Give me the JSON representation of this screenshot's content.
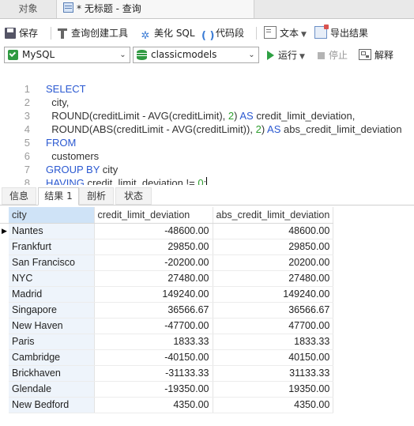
{
  "tabs": {
    "objects": "对象",
    "query_title": "* 无标题 - 查询"
  },
  "toolbar": {
    "save": "保存",
    "query_builder": "查询创建工具",
    "beautify_sql": "美化 SQL",
    "code_snippet": "代码段",
    "text": "文本",
    "export_results": "导出结果"
  },
  "connection": {
    "engine": "MySQL",
    "database": "classicmodels",
    "run": "运行",
    "stop": "停止",
    "explain": "解释"
  },
  "editor": {
    "line_numbers": [
      "1",
      "2",
      "3",
      "4",
      "5",
      "6",
      "7",
      "8"
    ]
  },
  "result_tabs": [
    "信息",
    "结果 1",
    "剖析",
    "状态"
  ],
  "results": {
    "columns": [
      "city",
      "credit_limit_deviation",
      "abs_credit_limit_deviation"
    ],
    "rows": [
      [
        "Nantes",
        "-48600.00",
        "48600.00"
      ],
      [
        "Frankfurt",
        "29850.00",
        "29850.00"
      ],
      [
        "San Francisco",
        "-20200.00",
        "20200.00"
      ],
      [
        "NYC",
        "27480.00",
        "27480.00"
      ],
      [
        "Madrid",
        "149240.00",
        "149240.00"
      ],
      [
        "Singapore",
        "36566.67",
        "36566.67"
      ],
      [
        "New Haven",
        "-47700.00",
        "47700.00"
      ],
      [
        "Paris",
        "1833.33",
        "1833.33"
      ],
      [
        "Cambridge",
        "-40150.00",
        "40150.00"
      ],
      [
        "Brickhaven",
        "-31133.33",
        "31133.33"
      ],
      [
        "Glendale",
        "-19350.00",
        "19350.00"
      ],
      [
        "New Bedford",
        "4350.00",
        "4350.00"
      ]
    ]
  },
  "colors": {
    "keyword": "#2b59d1",
    "number": "#2e9e2e",
    "run": "#2ea043",
    "selected_header": "#cfe3f7"
  }
}
